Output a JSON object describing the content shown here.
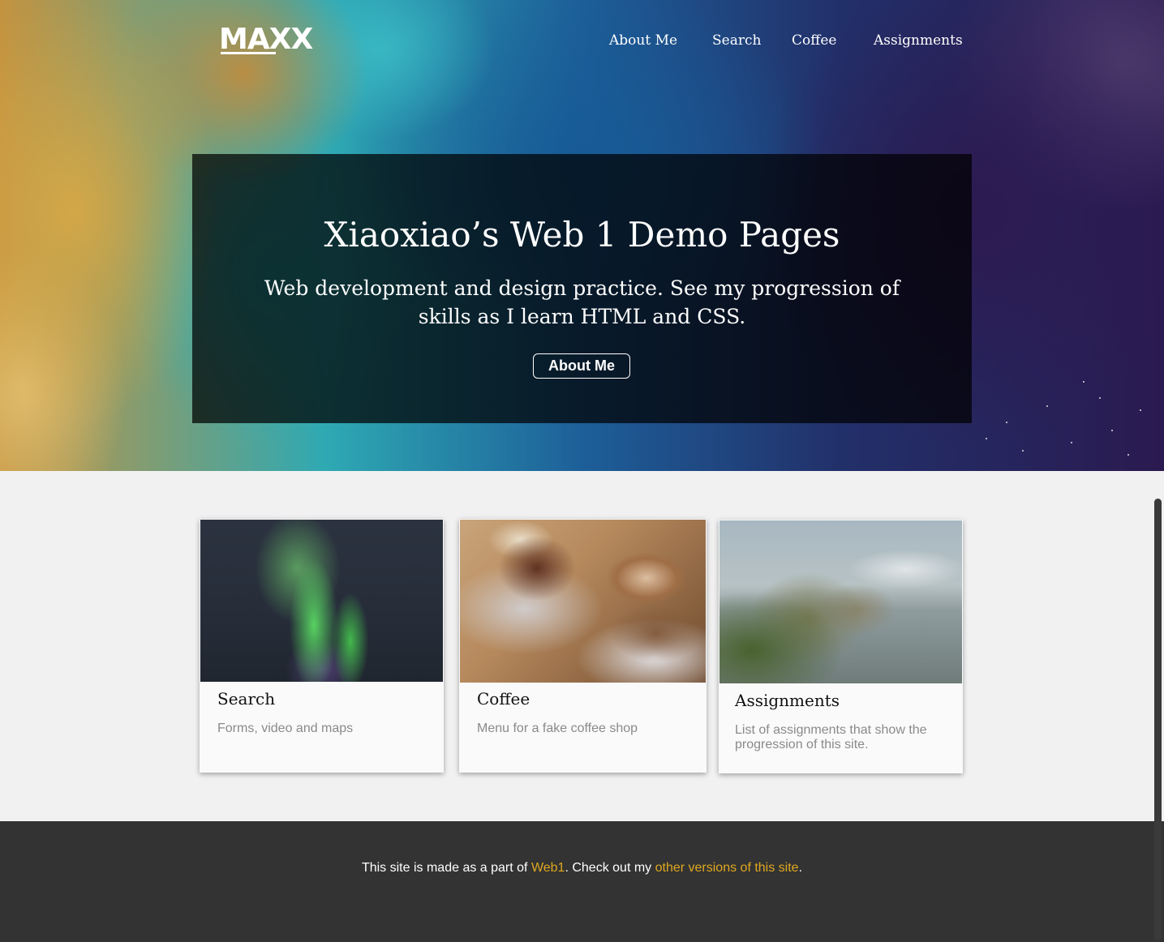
{
  "header": {
    "logo": "MAXX",
    "nav": [
      "About Me",
      "Search",
      "Coffee",
      "Assignments"
    ]
  },
  "hero": {
    "title": "Xiaoxiao’s Web 1 Demo Pages",
    "subtitle": "Web development and design practice. See my progression of skills as I learn HTML and CSS.",
    "button": "About Me"
  },
  "cards": [
    {
      "title": "Search",
      "description": "Forms, video and maps",
      "image": "aurora-photo"
    },
    {
      "title": "Coffee",
      "description": "Menu for a fake coffee shop",
      "image": "coffee-photo"
    },
    {
      "title": "Assignments",
      "description": "List of assignments that show the progression of this site.",
      "image": "coast-photo"
    }
  ],
  "footer": {
    "prefix": "This site is made as a part of ",
    "link1": "Web1",
    "middle": ". Check out my ",
    "link2": "other versions of this site",
    "suffix": "."
  },
  "colors": {
    "footer_bg": "#333333",
    "link": "#e0a820",
    "page_bg": "#f1f1f2"
  }
}
